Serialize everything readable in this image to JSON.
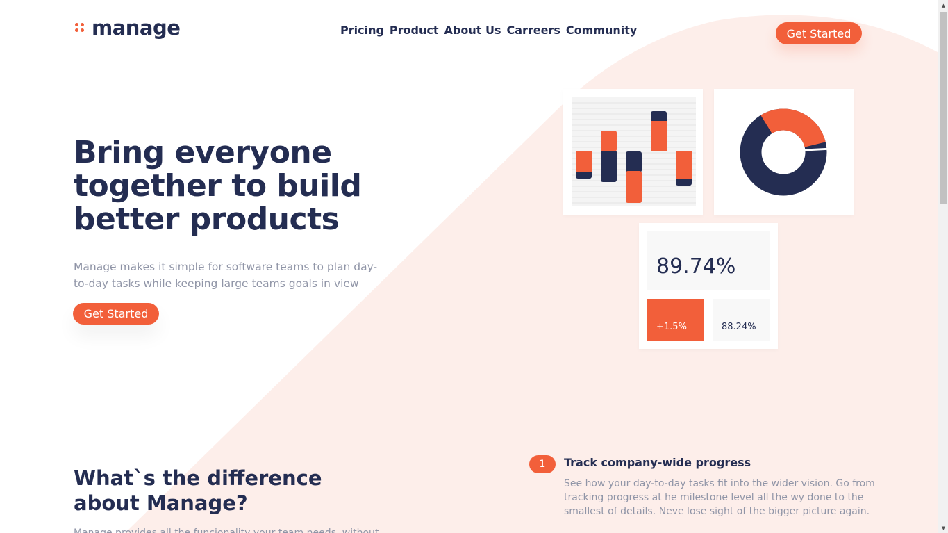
{
  "brand": {
    "name": "manage",
    "accent": "#f25f3a",
    "navy": "#242d52",
    "tint": "#fdeeea"
  },
  "nav": {
    "items": [
      {
        "label": "Pricing"
      },
      {
        "label": "Product"
      },
      {
        "label": "About Us"
      },
      {
        "label": "Carreers"
      },
      {
        "label": "Community"
      }
    ]
  },
  "header": {
    "cta_label": "Get Started"
  },
  "hero": {
    "title": "Bring everyone together to build better products",
    "description": "Manage makes it simple for software teams to plan day-to-day tasks while keeping large teams goals in view",
    "cta_label": "Get Started"
  },
  "illustration": {
    "stat_main": "89.74%",
    "stat_change": "+1.5%",
    "stat_secondary": "88.24%",
    "donut_share_accent": 0.3
  },
  "difference": {
    "title": "What`s the difference about Manage?",
    "description": "Manage provides all the funcionality your team needs, without"
  },
  "feature": {
    "number": "1",
    "title": "Track company-wide progress",
    "description": "See how your day-to-day tasks fit into the wider vision. Go from tracking progress at he milestone level all the wy done to the smallest of details. Neve lose sight of the bigger picture again."
  }
}
